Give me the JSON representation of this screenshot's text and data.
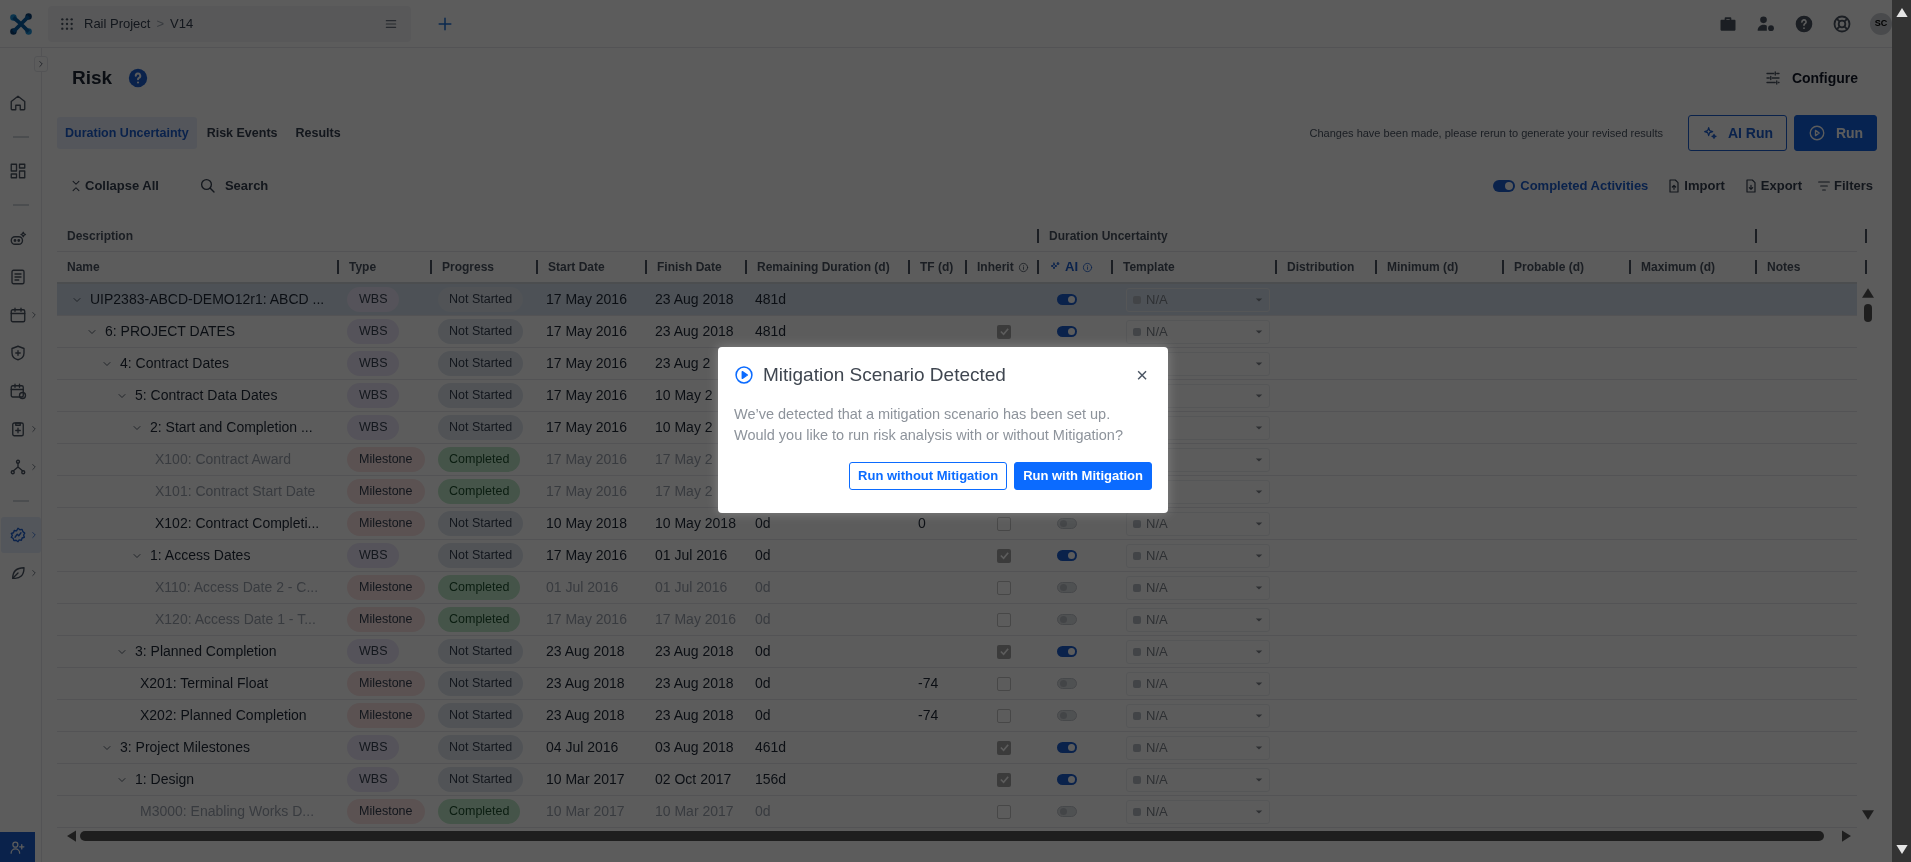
{
  "topbar": {
    "project": "Rail Project",
    "separator": ">",
    "version": "V14",
    "avatar": "SC"
  },
  "sidebar": {
    "groups": [
      [
        {
          "kind": "home",
          "selected": false,
          "submenu": false
        }
      ],
      [
        {
          "kind": "dashboard",
          "selected": false,
          "submenu": false
        }
      ],
      [
        {
          "kind": "bot",
          "selected": false,
          "submenu": false
        },
        {
          "kind": "form",
          "selected": false,
          "submenu": false
        },
        {
          "kind": "calendar",
          "selected": false,
          "submenu": true
        },
        {
          "kind": "shield",
          "selected": false,
          "submenu": false
        },
        {
          "kind": "calclock",
          "selected": false,
          "submenu": false
        },
        {
          "kind": "clipboard",
          "selected": false,
          "submenu": true
        },
        {
          "kind": "network",
          "selected": false,
          "submenu": true
        }
      ],
      [
        {
          "kind": "risk",
          "selected": true,
          "submenu": true
        },
        {
          "kind": "leaf",
          "selected": false,
          "submenu": true
        }
      ]
    ]
  },
  "page": {
    "title": "Risk",
    "configure": "Configure"
  },
  "tabs": [
    {
      "label": "Duration Uncertainty",
      "selected": true
    },
    {
      "label": "Risk Events",
      "selected": false
    },
    {
      "label": "Results",
      "selected": false
    }
  ],
  "notice": "Changes have been made, please rerun to generate your revised results",
  "actions": [
    {
      "label": "AI Run",
      "kind": "outline"
    },
    {
      "label": "Run",
      "kind": "primary"
    }
  ],
  "toolbar": {
    "collapse": "Collapse All",
    "search": "Search",
    "completed_activities": {
      "label": "Completed Activities",
      "on": true
    },
    "import": "Import",
    "export": "Export",
    "filters": "Filters"
  },
  "table": {
    "groups": [
      {
        "label": "Description"
      },
      {
        "label": "Duration Uncertainty"
      }
    ],
    "columns": [
      {
        "label": "Name",
        "kind": "plain"
      },
      {
        "label": "Type",
        "kind": "plain"
      },
      {
        "label": "Progress",
        "kind": "plain"
      },
      {
        "label": "Start Date",
        "kind": "plain"
      },
      {
        "label": "Finish Date",
        "kind": "plain"
      },
      {
        "label": "Remaining Duration (d)",
        "kind": "plain"
      },
      {
        "label": "TF (d)",
        "kind": "plain"
      },
      {
        "label": "Inherit",
        "kind": "info"
      },
      {
        "label": "AI",
        "kind": "ai"
      },
      {
        "label": "Template",
        "kind": "plain"
      },
      {
        "label": "Distribution",
        "kind": "plain"
      },
      {
        "label": "Minimum (d)",
        "kind": "plain"
      },
      {
        "label": "Probable (d)",
        "kind": "plain"
      },
      {
        "label": "Maximum (d)",
        "kind": "plain"
      },
      {
        "label": "Notes",
        "kind": "plain"
      }
    ],
    "rows": [
      {
        "name": "UIP2383-ABCD-DEMO12r1: ABCD ...",
        "type": "WBS",
        "kind": "wbs",
        "progress": "Not Started",
        "completed": false,
        "start": "17 May 2016",
        "finish": "23 Aug 2018",
        "remaining": "481d",
        "ai": true,
        "template": "N/A",
        "selected": true,
        "expanded": true,
        "children": [
          {
            "name": "6: PROJECT DATES",
            "type": "WBS",
            "kind": "wbs",
            "progress": "Not Started",
            "completed": false,
            "start": "17 May 2016",
            "finish": "23 Aug 2018",
            "remaining": "481d",
            "inherit": true,
            "ai": true,
            "template": "N/A",
            "selected": false,
            "expanded": true,
            "children": [
              {
                "name": "4: Contract Dates",
                "type": "WBS",
                "kind": "wbs",
                "progress": "Not Started",
                "completed": false,
                "start": "17 May 2016",
                "finish": "23 Aug 2",
                "selected": false,
                "expanded": true,
                "children": [
                  {
                    "name": "5: Contract Data Dates",
                    "type": "WBS",
                    "kind": "wbs",
                    "progress": "Not Started",
                    "completed": false,
                    "start": "17 May 2016",
                    "finish": "10 May 2",
                    "selected": false,
                    "expanded": true,
                    "children": [
                      {
                        "name": "2: Start and Completion ...",
                        "type": "WBS",
                        "kind": "wbs",
                        "progress": "Not Started",
                        "completed": false,
                        "start": "17 May 2016",
                        "finish": "10 May 2",
                        "selected": false,
                        "expanded": true,
                        "children": [
                          {
                            "name": "X100: Contract Award",
                            "type": "Milestone",
                            "kind": "milestone",
                            "progress": "Completed",
                            "completed": true,
                            "start": "17 May 2016",
                            "finish": "17 May 2",
                            "selected": false
                          },
                          {
                            "name": "X101: Contract Start Date",
                            "type": "Milestone",
                            "kind": "milestone",
                            "progress": "Completed",
                            "completed": true,
                            "start": "17 May 2016",
                            "finish": "17 May 2",
                            "selected": false
                          },
                          {
                            "name": "X102: Contract Completi...",
                            "type": "Milestone",
                            "kind": "milestone",
                            "progress": "Not Started",
                            "completed": false,
                            "start": "10 May 2018",
                            "finish": "10 May 2018",
                            "remaining": "0d",
                            "tf": "0",
                            "inherit": false,
                            "ai": false,
                            "template": "N/A",
                            "selected": false
                          }
                        ]
                      },
                      {
                        "name": "1: Access Dates",
                        "type": "WBS",
                        "kind": "wbs",
                        "progress": "Not Started",
                        "completed": false,
                        "start": "17 May 2016",
                        "finish": "01 Jul 2016",
                        "remaining": "0d",
                        "inherit": true,
                        "ai": true,
                        "template": "N/A",
                        "selected": false,
                        "expanded": true,
                        "children": [
                          {
                            "name": "X110: Access Date 2 - C...",
                            "type": "Milestone",
                            "kind": "milestone",
                            "progress": "Completed",
                            "completed": true,
                            "start": "01 Jul 2016",
                            "finish": "01 Jul 2016",
                            "remaining": "0d",
                            "inherit": false,
                            "ai": false,
                            "template": "N/A",
                            "selected": false
                          },
                          {
                            "name": "X120: Access Date 1 - T...",
                            "type": "Milestone",
                            "kind": "milestone",
                            "progress": "Completed",
                            "completed": true,
                            "start": "17 May 2016",
                            "finish": "17 May 2016",
                            "remaining": "0d",
                            "inherit": false,
                            "ai": false,
                            "template": "N/A",
                            "selected": false
                          }
                        ]
                      }
                    ]
                  },
                  {
                    "name": "3: Planned Completion",
                    "type": "WBS",
                    "kind": "wbs",
                    "progress": "Not Started",
                    "completed": false,
                    "start": "23 Aug 2018",
                    "finish": "23 Aug 2018",
                    "remaining": "0d",
                    "inherit": true,
                    "ai": true,
                    "template": "N/A",
                    "selected": false,
                    "expanded": true,
                    "children": [
                      {
                        "name": "X201: Terminal Float",
                        "type": "Milestone",
                        "kind": "milestone",
                        "progress": "Not Started",
                        "completed": false,
                        "start": "23 Aug 2018",
                        "finish": "23 Aug 2018",
                        "remaining": "0d",
                        "tf": "-74",
                        "inherit": false,
                        "ai": false,
                        "template": "N/A",
                        "selected": false
                      },
                      {
                        "name": "X202: Planned Completion",
                        "type": "Milestone",
                        "kind": "milestone",
                        "progress": "Not Started",
                        "completed": false,
                        "start": "23 Aug 2018",
                        "finish": "23 Aug 2018",
                        "remaining": "0d",
                        "tf": "-74",
                        "inherit": false,
                        "ai": false,
                        "template": "N/A",
                        "selected": false
                      }
                    ]
                  }
                ]
              },
              {
                "name": "3: Project Milestones",
                "type": "WBS",
                "kind": "wbs",
                "progress": "Not Started",
                "completed": false,
                "start": "04 Jul 2016",
                "finish": "03 Aug 2018",
                "remaining": "461d",
                "inherit": true,
                "ai": true,
                "template": "N/A",
                "selected": false,
                "expanded": true,
                "children": [
                  {
                    "name": "1: Design",
                    "type": "WBS",
                    "kind": "wbs",
                    "progress": "Not Started",
                    "completed": false,
                    "start": "10 Mar 2017",
                    "finish": "02 Oct 2017",
                    "remaining": "156d",
                    "inherit": true,
                    "ai": true,
                    "template": "N/A",
                    "selected": false,
                    "expanded": true,
                    "children": [
                      {
                        "name": "M3000: Enabling Works D...",
                        "type": "Milestone",
                        "kind": "milestone",
                        "progress": "Completed",
                        "completed": true,
                        "start": "10 Mar 2017",
                        "finish": "10 Mar 2017",
                        "remaining": "0d",
                        "inherit": false,
                        "ai": false,
                        "template": "N/A",
                        "selected": false
                      }
                    ]
                  }
                ]
              }
            ]
          }
        ]
      }
    ]
  },
  "dialog": {
    "title": "Mitigation Scenario Detected",
    "message": "We’ve detected that a mitigation scenario has been set up. Would you like to run risk analysis with or without Mitigation?",
    "close": "×",
    "buttons": [
      {
        "label": "Run without Mitigation",
        "kind": "outline"
      },
      {
        "label": "Run with Mitigation",
        "kind": "primary"
      }
    ]
  }
}
